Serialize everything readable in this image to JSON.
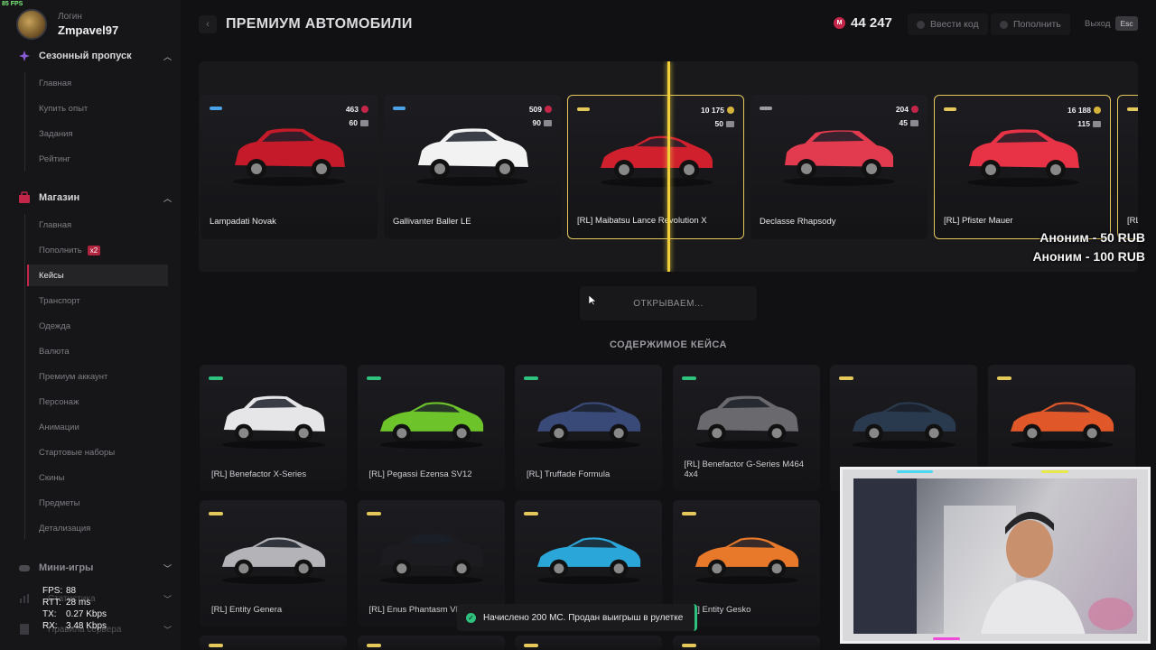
{
  "overlay": {
    "fps": "85 FPS"
  },
  "profile": {
    "login_label": "Логин",
    "nickname": "Zmpavel97"
  },
  "sidebar": {
    "season": {
      "title": "Сезонный пропуск",
      "items": [
        "Главная",
        "Купить опыт",
        "Задания",
        "Рейтинг"
      ]
    },
    "shop": {
      "title": "Магазин",
      "items": [
        {
          "label": "Главная"
        },
        {
          "label": "Пополнить",
          "badge": "x2"
        },
        {
          "label": "Кейсы",
          "active": true
        },
        {
          "label": "Транспорт"
        },
        {
          "label": "Одежда"
        },
        {
          "label": "Валюта"
        },
        {
          "label": "Премиум аккаунт"
        },
        {
          "label": "Персонаж"
        },
        {
          "label": "Анимации"
        },
        {
          "label": "Стартовые наборы"
        },
        {
          "label": "Скины"
        },
        {
          "label": "Предметы"
        },
        {
          "label": "Детализация"
        }
      ]
    },
    "minigames": {
      "title": "Мини-игры"
    },
    "stats_partial": "Статистика",
    "rules_partial": "Правила сервера"
  },
  "netstats": [
    {
      "k": "FPS:",
      "v": "88"
    },
    {
      "k": "RTT:",
      "v": "28 ms"
    },
    {
      "k": "TX:",
      "v": "0.27 Kbps"
    },
    {
      "k": "RX:",
      "v": "3.48 Kbps"
    }
  ],
  "header": {
    "title": "ПРЕМИУМ АВТОМОБИЛИ",
    "balance": "44 247",
    "currency_symbol": "M",
    "redeem_label": "Ввести код",
    "topup_label": "Пополнить",
    "exit_label": "Выход",
    "esc_label": "Esc"
  },
  "colors": {
    "accent": "#c4264a",
    "gold": "#e4c95a",
    "needle": "#f0cf3a",
    "green": "#2ec27e",
    "blue": "#4aa3e8",
    "grey": "#9a9aa0"
  },
  "roulette": [
    {
      "name": "Lampadati Novak",
      "price": "463",
      "currency": "r",
      "kg": "60",
      "tag": "blue",
      "car_color": "#c41a2a",
      "shape": "suv"
    },
    {
      "name": "Gallivanter Baller LE",
      "price": "509",
      "currency": "r",
      "kg": "90",
      "tag": "blue",
      "car_color": "#f2f2f2",
      "shape": "suv"
    },
    {
      "name": "[RL] Maibatsu Lance Revolution X",
      "price": "10 175",
      "currency": "g",
      "kg": "50",
      "tag": "gold",
      "car_color": "#d0202e",
      "shape": "sedan",
      "highlight": true
    },
    {
      "name": "Declasse Rhapsody",
      "price": "204",
      "currency": "r",
      "kg": "45",
      "tag": "grey",
      "car_color": "#e23a4e",
      "shape": "hatch"
    },
    {
      "name": "[RL] Pfister Mauer",
      "price": "16 188",
      "currency": "g",
      "kg": "115",
      "tag": "gold",
      "car_color": "#e83246",
      "shape": "suv",
      "highlight": true
    },
    {
      "name": "[RL]",
      "price": "",
      "currency": "g",
      "kg": "",
      "tag": "gold",
      "car_color": "#c0202e",
      "shape": "sedan",
      "highlight": true
    }
  ],
  "donations": [
    "Аноним - 50 RUB",
    "Аноним - 100 RUB"
  ],
  "open_button": "ОТКРЫВАЕМ...",
  "content_title": "СОДЕРЖИМОЕ КЕЙСА",
  "contents": [
    {
      "name": "[RL] Benefactor X-Series",
      "tag": "green",
      "car_color": "#e6e6e8",
      "shape": "pickup"
    },
    {
      "name": "[RL] Pegassi Ezensa SV12",
      "tag": "green",
      "car_color": "#6cc42a",
      "shape": "super"
    },
    {
      "name": "[RL] Truffade Formula",
      "tag": "green",
      "car_color": "#3a4a78",
      "shape": "hyper"
    },
    {
      "name": "[RL] Benefactor G-Series M464 4x4",
      "tag": "green",
      "car_color": "#6a6a6e",
      "shape": "box"
    },
    {
      "name": "",
      "tag": "gold",
      "car_color": "#2a3a4e",
      "shape": "hyper"
    },
    {
      "name": "",
      "tag": "gold",
      "car_color": "#e0582a",
      "shape": "super"
    },
    {
      "name": "[RL] Entity Genera",
      "tag": "gold",
      "car_color": "#b4b4b8",
      "shape": "super"
    },
    {
      "name": "[RL] Enus Phantasm VIII",
      "tag": "gold",
      "car_color": "#1c1c20",
      "shape": "lux"
    },
    {
      "name": "",
      "tag": "gold",
      "car_color": "#2aa6d8",
      "shape": "super"
    },
    {
      "name": "[RL] Entity Gesko",
      "tag": "gold",
      "car_color": "#e8782a",
      "shape": "hyper"
    }
  ],
  "toast": "Начислено 200 МС. Продан выигрыш в рулетке"
}
